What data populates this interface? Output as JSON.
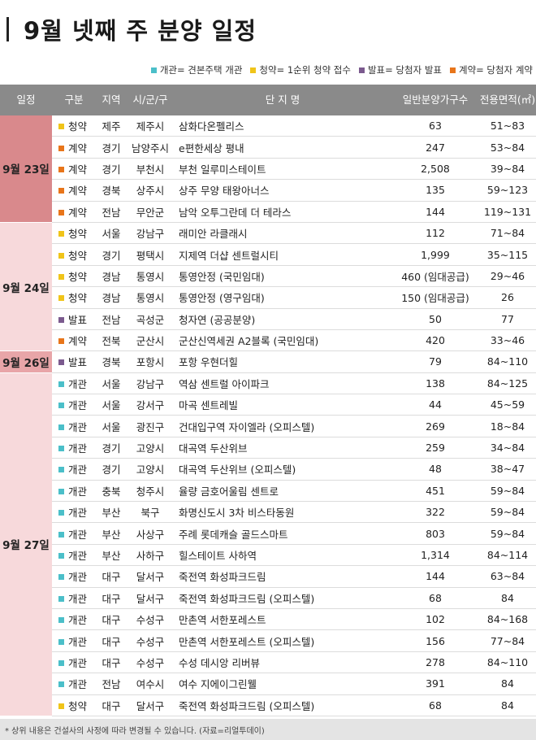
{
  "title": "9월 넷째 주 분양 일정",
  "legend": [
    {
      "text": "개관= 견본주택 개관",
      "color": "#4bbfc9"
    },
    {
      "text": "청약= 1순위 청약 접수",
      "color": "#f0c419"
    },
    {
      "text": "발표= 당첨자 발표",
      "color": "#7b5a8e"
    },
    {
      "text": "계약= 당첨자 계약",
      "color": "#e8751a"
    }
  ],
  "headers": {
    "date": "일정",
    "type": "구분",
    "region": "지역",
    "city": "시/군/구",
    "name": "단 지 명",
    "units": "일반분양가구수",
    "area": "전용면적(㎡)"
  },
  "colors": {
    "개관": "#4bbfc9",
    "청약": "#f0c419",
    "발표": "#7b5a8e",
    "계약": "#e8751a"
  },
  "groups": [
    {
      "date": "9월 23일",
      "rows": [
        {
          "type": "청약",
          "region": "제주",
          "city": "제주시",
          "name": "삼화다온펠리스",
          "units": "63",
          "area": "51~83"
        },
        {
          "type": "계약",
          "region": "경기",
          "city": "남양주시",
          "name": "e편한세상 평내",
          "units": "247",
          "area": "53~84"
        },
        {
          "type": "계약",
          "region": "경기",
          "city": "부천시",
          "name": "부천 일루미스테이트",
          "units": "2,508",
          "area": "39~84"
        },
        {
          "type": "계약",
          "region": "경북",
          "city": "상주시",
          "name": "상주 무양 태왕아너스",
          "units": "135",
          "area": "59~123"
        },
        {
          "type": "계약",
          "region": "전남",
          "city": "무안군",
          "name": "남악 오투그란데 더 테라스",
          "units": "144",
          "area": "119~131"
        }
      ]
    },
    {
      "date": "9월 24일",
      "rows": [
        {
          "type": "청약",
          "region": "서울",
          "city": "강남구",
          "name": "래미안 라클래시",
          "units": "112",
          "area": "71~84"
        },
        {
          "type": "청약",
          "region": "경기",
          "city": "평택시",
          "name": "지제역 더샵 센트럴시티",
          "units": "1,999",
          "area": "35~115"
        },
        {
          "type": "청약",
          "region": "경남",
          "city": "통영시",
          "name": "통영안정 (국민임대)",
          "units": "460 (임대공급)",
          "area": "29~46"
        },
        {
          "type": "청약",
          "region": "경남",
          "city": "통영시",
          "name": "통영안정 (영구임대)",
          "units": "150 (임대공급)",
          "area": "26"
        },
        {
          "type": "발표",
          "region": "전남",
          "city": "곡성군",
          "name": "청자연 (공공분양)",
          "units": "50",
          "area": "77"
        },
        {
          "type": "계약",
          "region": "전북",
          "city": "군산시",
          "name": "군산신역세권 A2블록 (국민임대)",
          "units": "420",
          "area": "33~46"
        }
      ]
    },
    {
      "date": "9월 26일",
      "rows": [
        {
          "type": "발표",
          "region": "경북",
          "city": "포항시",
          "name": "포항 우현더힐",
          "units": "79",
          "area": "84~110"
        }
      ]
    },
    {
      "date": "9월 27일",
      "rows": [
        {
          "type": "개관",
          "region": "서울",
          "city": "강남구",
          "name": "역삼 센트럴 아이파크",
          "units": "138",
          "area": "84~125"
        },
        {
          "type": "개관",
          "region": "서울",
          "city": "강서구",
          "name": "마곡 센트레빌",
          "units": "44",
          "area": "45~59"
        },
        {
          "type": "개관",
          "region": "서울",
          "city": "광진구",
          "name": "건대입구역 자이엘라 (오피스텔)",
          "units": "269",
          "area": "18~84"
        },
        {
          "type": "개관",
          "region": "경기",
          "city": "고양시",
          "name": "대곡역 두산위브",
          "units": "259",
          "area": "34~84"
        },
        {
          "type": "개관",
          "region": "경기",
          "city": "고양시",
          "name": "대곡역 두산위브 (오피스텔)",
          "units": "48",
          "area": "38~47"
        },
        {
          "type": "개관",
          "region": "충북",
          "city": "청주시",
          "name": "율량 금호어울림 센트로",
          "units": "451",
          "area": "59~84"
        },
        {
          "type": "개관",
          "region": "부산",
          "city": "북구",
          "name": "화명신도시 3차 비스타동원",
          "units": "322",
          "area": "59~84"
        },
        {
          "type": "개관",
          "region": "부산",
          "city": "사상구",
          "name": "주례 롯데캐슬 골드스마트",
          "units": "803",
          "area": "59~84"
        },
        {
          "type": "개관",
          "region": "부산",
          "city": "사하구",
          "name": "힐스테이트 사하역",
          "units": "1,314",
          "area": "84~114"
        },
        {
          "type": "개관",
          "region": "대구",
          "city": "달서구",
          "name": "죽전역 화성파크드림",
          "units": "144",
          "area": "63~84"
        },
        {
          "type": "개관",
          "region": "대구",
          "city": "달서구",
          "name": "죽전역 화성파크드림 (오피스텔)",
          "units": "68",
          "area": "84"
        },
        {
          "type": "개관",
          "region": "대구",
          "city": "수성구",
          "name": "만촌역 서한포레스트",
          "units": "102",
          "area": "84~168"
        },
        {
          "type": "개관",
          "region": "대구",
          "city": "수성구",
          "name": "만촌역 서한포레스트 (오피스텔)",
          "units": "156",
          "area": "77~84"
        },
        {
          "type": "개관",
          "region": "대구",
          "city": "수성구",
          "name": "수성 데시앙 리버뷰",
          "units": "278",
          "area": "84~110"
        },
        {
          "type": "개관",
          "region": "전남",
          "city": "여수시",
          "name": "여수 지에이그린웰",
          "units": "391",
          "area": "84"
        },
        {
          "type": "청약",
          "region": "대구",
          "city": "달서구",
          "name": "죽전역 화성파크드림 (오피스텔)",
          "units": "68",
          "area": "84"
        }
      ]
    }
  ],
  "footer": "* 상위 내용은 건설사의 사정에 따라 변경될 수 있습니다. (자료=리얼투데이)"
}
